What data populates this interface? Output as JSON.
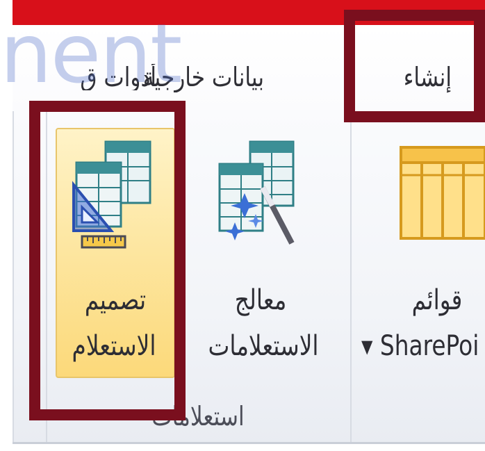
{
  "ribbon_tabs": {
    "create": "إنشاء",
    "external_data": "بيانات خارجية",
    "database_tools": "أدوات ق"
  },
  "watermark": {
    "text": "nent"
  },
  "buttons": {
    "sharepoint_lists": {
      "line1": "قوائم",
      "line2": "▾ SharePoi",
      "icon": "table-grid-icon"
    },
    "query_wizard": {
      "line1": "معالج",
      "line2": "الاستعلامات",
      "icon": "query-wizard-icon"
    },
    "query_design": {
      "line1": "تصميم",
      "line2": "الاستعلام",
      "icon": "query-design-icon"
    }
  },
  "group": {
    "label": "استعلامات"
  },
  "colors": {
    "tab_bar_red": "#d8101a",
    "highlight_frame": "#7a0f1e",
    "selected_button": "#fde7a3"
  }
}
